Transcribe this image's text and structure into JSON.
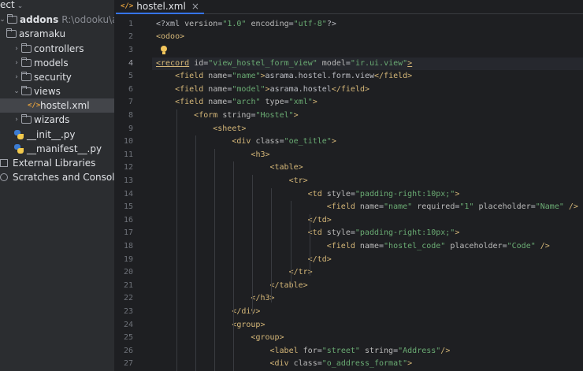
{
  "project_panel": {
    "header": "ect",
    "tree": [
      {
        "label": "addons",
        "path": "R:\\odooku\\addons",
        "icon": "folder-icon",
        "arrow": "down",
        "bold": true
      },
      {
        "label": "asramaku",
        "icon": "folder-icon",
        "arrow": ""
      },
      {
        "label": "controllers",
        "icon": "folder-icon",
        "arrow": "right"
      },
      {
        "label": "models",
        "icon": "folder-icon",
        "arrow": "right"
      },
      {
        "label": "security",
        "icon": "folder-icon",
        "arrow": "right"
      },
      {
        "label": "views",
        "icon": "folder-icon",
        "arrow": "down"
      },
      {
        "label": "hostel.xml",
        "icon": "xml-file-icon",
        "arrow": "",
        "selected": true
      },
      {
        "label": "wizards",
        "icon": "folder-icon",
        "arrow": "right"
      },
      {
        "label": "__init__.py",
        "icon": "python-file-icon",
        "arrow": ""
      },
      {
        "label": "__manifest__.py",
        "icon": "python-file-icon",
        "arrow": ""
      },
      {
        "label": "External Libraries",
        "icon": "library-icon",
        "arrow": ""
      },
      {
        "label": "Scratches and Consoles",
        "icon": "scratches-icon",
        "arrow": ""
      }
    ]
  },
  "editor": {
    "tab": {
      "label": "hostel.xml",
      "icon": "xml-file-icon",
      "close": "×"
    },
    "current_line": 4,
    "colors": {
      "tag": "#d5b778",
      "attr": "#bababa",
      "value": "#6aab73",
      "text": "#bcbec4",
      "background": "#1e1f22"
    },
    "lines": [
      {
        "n": "1",
        "tokens": [
          [
            "d",
            "<?xml "
          ],
          [
            "a",
            "version"
          ],
          [
            "p",
            "="
          ],
          [
            "v",
            "\"1.0\""
          ],
          [
            "p",
            " "
          ],
          [
            "a",
            "encoding"
          ],
          [
            "p",
            "="
          ],
          [
            "v",
            "\"utf-8\""
          ],
          [
            "d",
            "?>"
          ]
        ]
      },
      {
        "n": "2",
        "tokens": [
          [
            "t",
            "<odoo>"
          ]
        ]
      },
      {
        "n": "3",
        "tokens": []
      },
      {
        "n": "4",
        "tokens": [
          [
            "t",
            "<record"
          ],
          [
            "p",
            " "
          ],
          [
            "a",
            "id"
          ],
          [
            "p",
            "="
          ],
          [
            "v",
            "\"view_hostel_form_view\""
          ],
          [
            "p",
            " "
          ],
          [
            "a",
            "model"
          ],
          [
            "p",
            "="
          ],
          [
            "v",
            "\"ir.ui.view\""
          ],
          [
            "t",
            ">"
          ]
        ]
      },
      {
        "n": "5",
        "tokens": [
          [
            "p",
            "    "
          ],
          [
            "t",
            "<field"
          ],
          [
            "p",
            " "
          ],
          [
            "a",
            "name"
          ],
          [
            "p",
            "="
          ],
          [
            "v",
            "\"name\""
          ],
          [
            "t",
            ">"
          ],
          [
            "p",
            "asrama.hostel.form.view"
          ],
          [
            "t",
            "</field>"
          ]
        ]
      },
      {
        "n": "6",
        "tokens": [
          [
            "p",
            "    "
          ],
          [
            "t",
            "<field"
          ],
          [
            "p",
            " "
          ],
          [
            "a",
            "name"
          ],
          [
            "p",
            "="
          ],
          [
            "v",
            "\"model\""
          ],
          [
            "t",
            ">"
          ],
          [
            "p",
            "asrama.hostel"
          ],
          [
            "t",
            "</field>"
          ]
        ]
      },
      {
        "n": "7",
        "tokens": [
          [
            "p",
            "    "
          ],
          [
            "t",
            "<field"
          ],
          [
            "p",
            " "
          ],
          [
            "a",
            "name"
          ],
          [
            "p",
            "="
          ],
          [
            "v",
            "\"arch\""
          ],
          [
            "p",
            " "
          ],
          [
            "a",
            "type"
          ],
          [
            "p",
            "="
          ],
          [
            "v",
            "\"xml\""
          ],
          [
            "t",
            ">"
          ]
        ]
      },
      {
        "n": "8",
        "tokens": [
          [
            "p",
            "        "
          ],
          [
            "t",
            "<form"
          ],
          [
            "p",
            " "
          ],
          [
            "a",
            "string"
          ],
          [
            "p",
            "="
          ],
          [
            "v",
            "\"Hostel\""
          ],
          [
            "t",
            ">"
          ]
        ]
      },
      {
        "n": "9",
        "tokens": [
          [
            "p",
            "            "
          ],
          [
            "t",
            "<sheet>"
          ]
        ]
      },
      {
        "n": "10",
        "tokens": [
          [
            "p",
            "                "
          ],
          [
            "t",
            "<div"
          ],
          [
            "p",
            " "
          ],
          [
            "a",
            "class"
          ],
          [
            "p",
            "="
          ],
          [
            "v",
            "\"oe_title\""
          ],
          [
            "t",
            ">"
          ]
        ]
      },
      {
        "n": "11",
        "tokens": [
          [
            "p",
            "                    "
          ],
          [
            "t",
            "<h3>"
          ]
        ]
      },
      {
        "n": "12",
        "tokens": [
          [
            "p",
            "                        "
          ],
          [
            "t",
            "<table>"
          ]
        ]
      },
      {
        "n": "13",
        "tokens": [
          [
            "p",
            "                            "
          ],
          [
            "t",
            "<tr>"
          ]
        ]
      },
      {
        "n": "14",
        "tokens": [
          [
            "p",
            "                                "
          ],
          [
            "t",
            "<td"
          ],
          [
            "p",
            " "
          ],
          [
            "a",
            "style"
          ],
          [
            "p",
            "="
          ],
          [
            "v",
            "\"padding-right:10px;\""
          ],
          [
            "t",
            ">"
          ]
        ]
      },
      {
        "n": "15",
        "tokens": [
          [
            "p",
            "                                    "
          ],
          [
            "t",
            "<field"
          ],
          [
            "p",
            " "
          ],
          [
            "a",
            "name"
          ],
          [
            "p",
            "="
          ],
          [
            "v",
            "\"name\""
          ],
          [
            "p",
            " "
          ],
          [
            "a",
            "required"
          ],
          [
            "p",
            "="
          ],
          [
            "v",
            "\"1\""
          ],
          [
            "p",
            " "
          ],
          [
            "a",
            "placeholder"
          ],
          [
            "p",
            "="
          ],
          [
            "v",
            "\"Name\""
          ],
          [
            "p",
            " "
          ],
          [
            "t",
            "/>"
          ]
        ]
      },
      {
        "n": "16",
        "tokens": [
          [
            "p",
            "                                "
          ],
          [
            "t",
            "</td>"
          ]
        ]
      },
      {
        "n": "17",
        "tokens": [
          [
            "p",
            "                                "
          ],
          [
            "t",
            "<td"
          ],
          [
            "p",
            " "
          ],
          [
            "a",
            "style"
          ],
          [
            "p",
            "="
          ],
          [
            "v",
            "\"padding-right:10px;\""
          ],
          [
            "t",
            ">"
          ]
        ]
      },
      {
        "n": "18",
        "tokens": [
          [
            "p",
            "                                    "
          ],
          [
            "t",
            "<field"
          ],
          [
            "p",
            " "
          ],
          [
            "a",
            "name"
          ],
          [
            "p",
            "="
          ],
          [
            "v",
            "\"hostel_code\""
          ],
          [
            "p",
            " "
          ],
          [
            "a",
            "placeholder"
          ],
          [
            "p",
            "="
          ],
          [
            "v",
            "\"Code\""
          ],
          [
            "p",
            " "
          ],
          [
            "t",
            "/>"
          ]
        ]
      },
      {
        "n": "19",
        "tokens": [
          [
            "p",
            "                                "
          ],
          [
            "t",
            "</td>"
          ]
        ]
      },
      {
        "n": "20",
        "tokens": [
          [
            "p",
            "                            "
          ],
          [
            "t",
            "</tr>"
          ]
        ]
      },
      {
        "n": "21",
        "tokens": [
          [
            "p",
            "                        "
          ],
          [
            "t",
            "</table>"
          ]
        ]
      },
      {
        "n": "22",
        "tokens": [
          [
            "p",
            "                    "
          ],
          [
            "t",
            "</h3>"
          ]
        ]
      },
      {
        "n": "23",
        "tokens": [
          [
            "p",
            "                "
          ],
          [
            "t",
            "</div>"
          ]
        ]
      },
      {
        "n": "24",
        "tokens": [
          [
            "p",
            "                "
          ],
          [
            "t",
            "<group>"
          ]
        ]
      },
      {
        "n": "25",
        "tokens": [
          [
            "p",
            "                    "
          ],
          [
            "t",
            "<group>"
          ]
        ]
      },
      {
        "n": "26",
        "tokens": [
          [
            "p",
            "                        "
          ],
          [
            "t",
            "<label"
          ],
          [
            "p",
            " "
          ],
          [
            "a",
            "for"
          ],
          [
            "p",
            "="
          ],
          [
            "v",
            "\"street\""
          ],
          [
            "p",
            " "
          ],
          [
            "a",
            "string"
          ],
          [
            "p",
            "="
          ],
          [
            "v",
            "\"Address\""
          ],
          [
            "t",
            "/>"
          ]
        ]
      },
      {
        "n": "27",
        "tokens": [
          [
            "p",
            "                        "
          ],
          [
            "t",
            "<div"
          ],
          [
            "p",
            " "
          ],
          [
            "a",
            "class"
          ],
          [
            "p",
            "="
          ],
          [
            "v",
            "\"o_address_format\""
          ],
          [
            "t",
            ">"
          ]
        ]
      }
    ]
  }
}
